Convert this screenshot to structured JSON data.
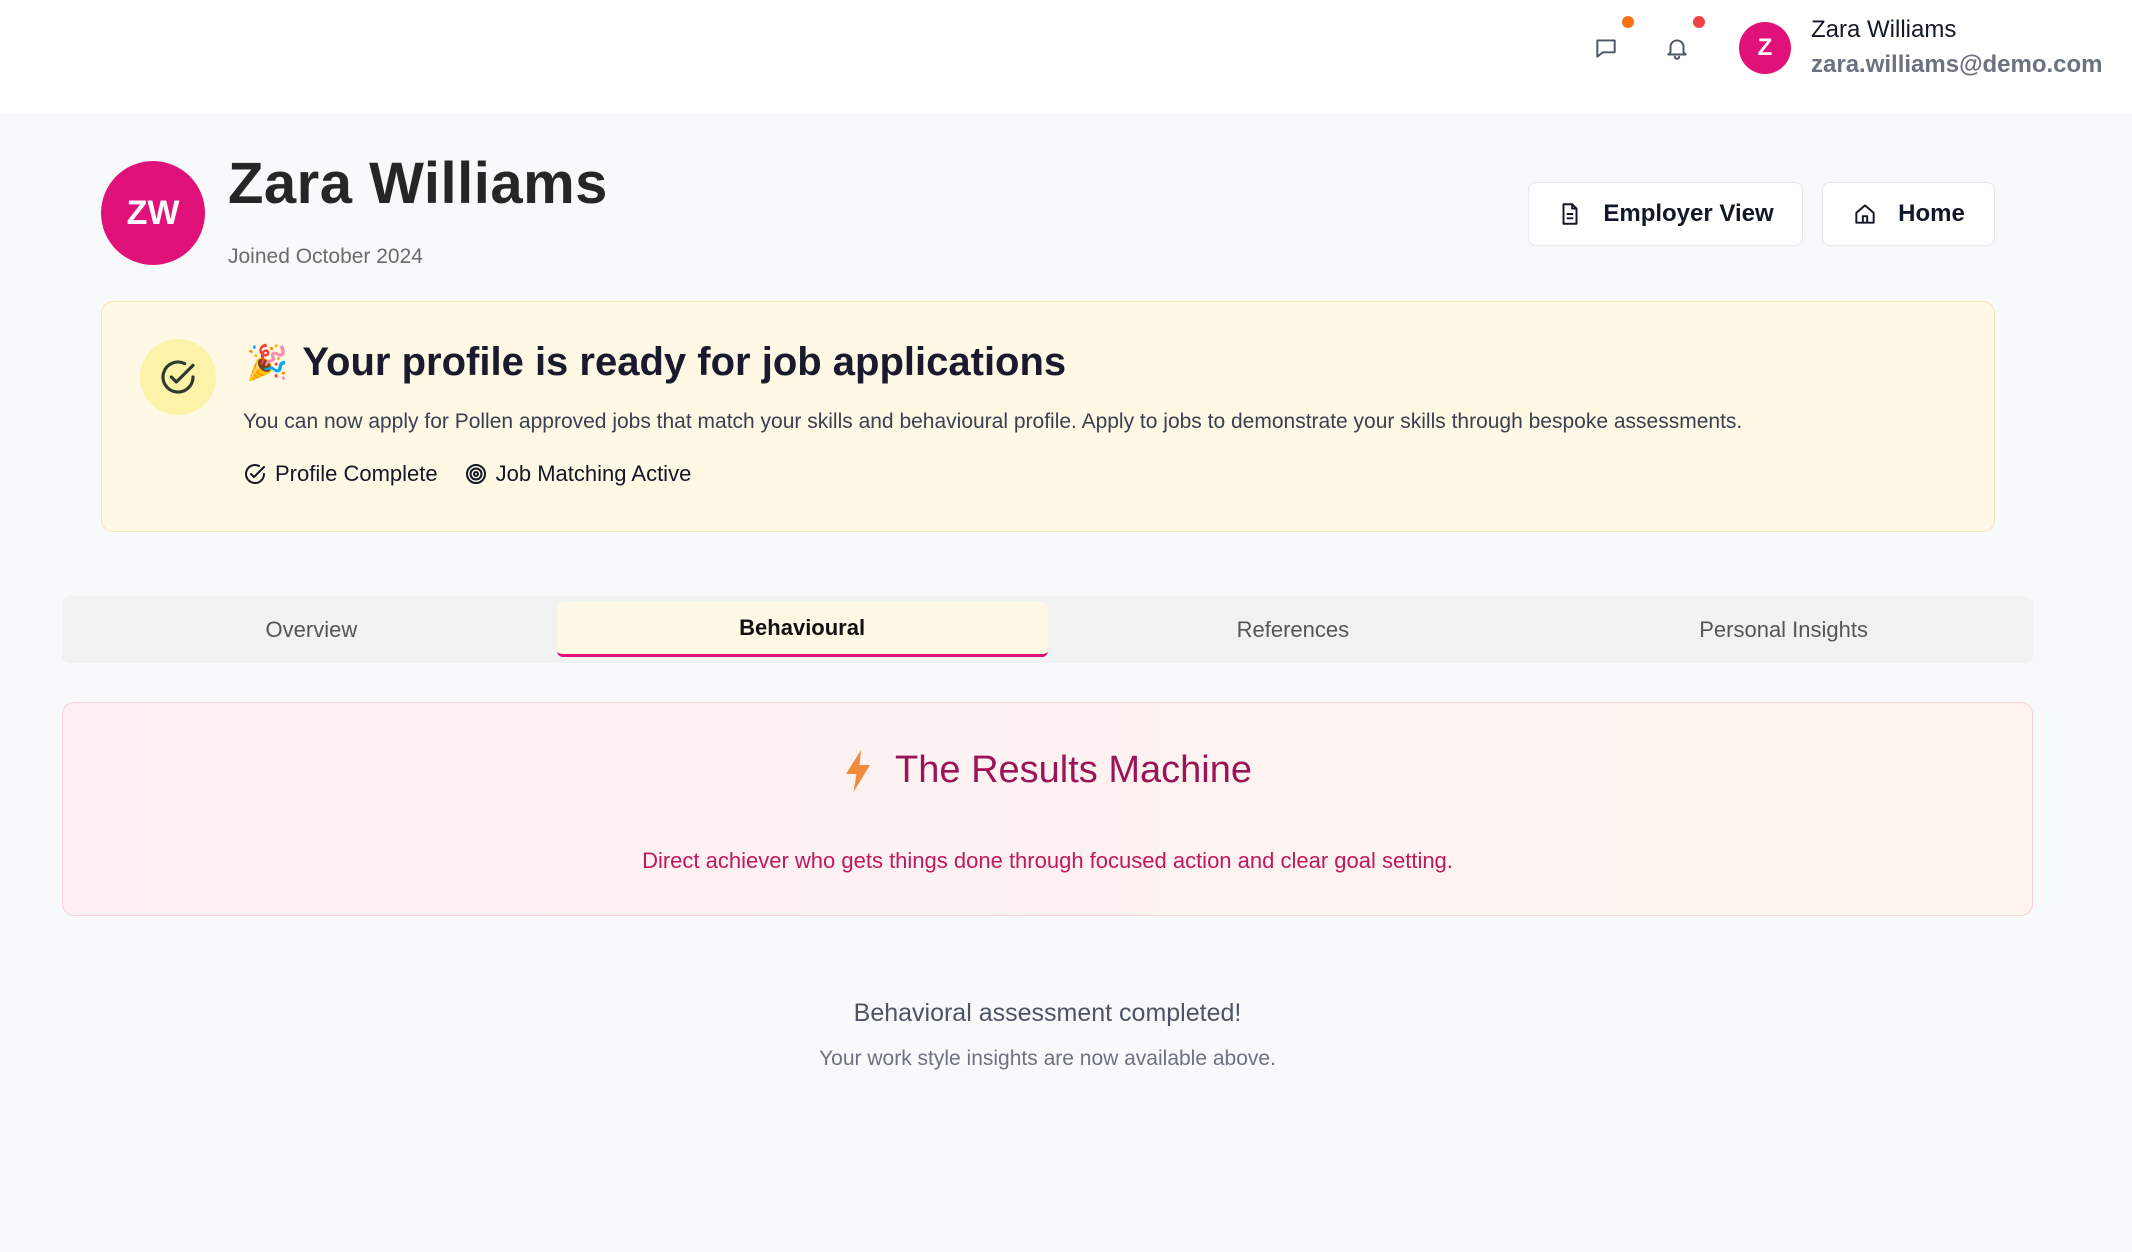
{
  "topbar": {
    "user_initial": "Z",
    "user_name": "Zara Williams",
    "user_email": "zara.williams@demo.com",
    "icons": {
      "messages": "message-icon",
      "notifications": "bell-icon"
    },
    "colors": {
      "messages_dot": "#f97316",
      "notifications_dot": "#ef4444"
    }
  },
  "profile": {
    "initials": "ZW",
    "name": "Zara Williams",
    "joined": "Joined October 2024",
    "buttons": {
      "employer_view": "Employer View",
      "home": "Home"
    }
  },
  "banner": {
    "emoji": "🎉",
    "title": "Your profile is ready for job applications",
    "description": "You can now apply for Pollen approved jobs that match your skills and behavioural profile. Apply to jobs to demonstrate your skills through bespoke assessments.",
    "badges": {
      "profile_complete": "Profile Complete",
      "job_matching": "Job Matching Active"
    }
  },
  "tabs": [
    {
      "label": "Overview",
      "active": false
    },
    {
      "label": "Behavioural",
      "active": true
    },
    {
      "label": "References",
      "active": false
    },
    {
      "label": "Personal Insights",
      "active": false
    }
  ],
  "result": {
    "title": "The Results Machine",
    "description": "Direct achiever who gets things done through focused action and clear goal setting."
  },
  "completion": {
    "title": "Behavioral assessment completed!",
    "subtitle": "Your work style insights are now available above."
  },
  "theme": {
    "brand": "#e0127a",
    "banner_bg": "#fef8e4",
    "result_title": "#9b1556"
  }
}
